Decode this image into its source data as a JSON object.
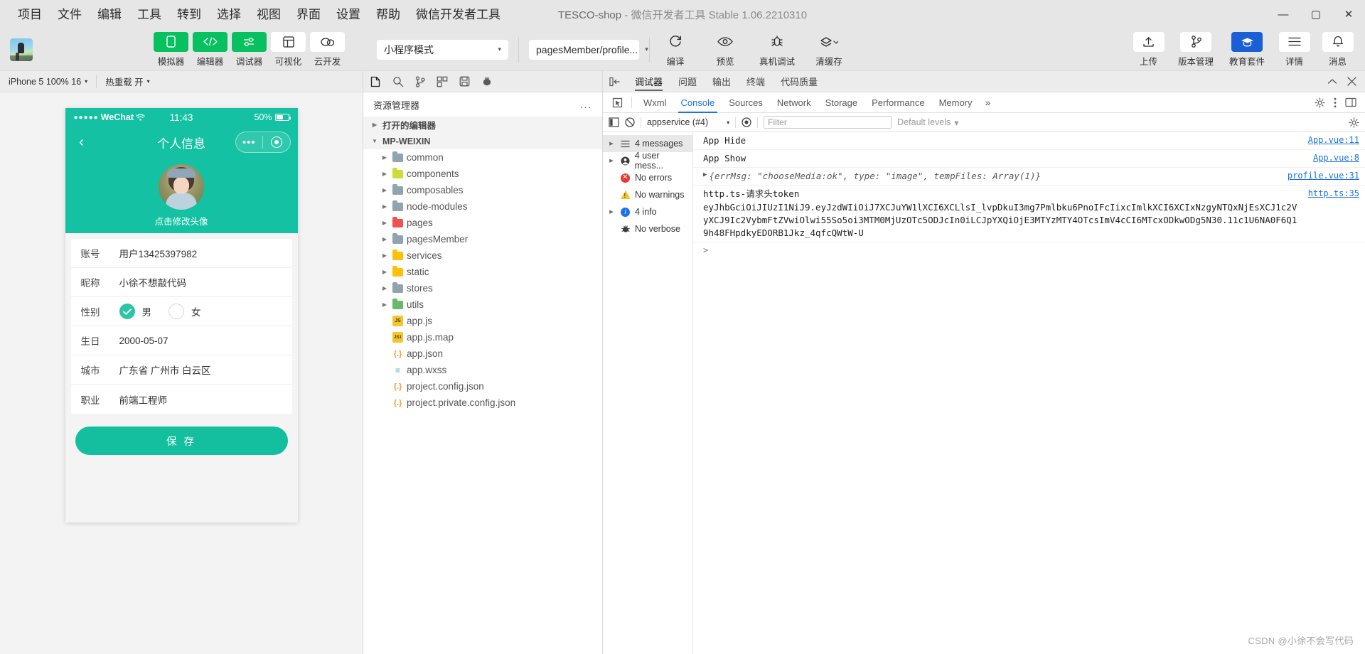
{
  "window": {
    "project": "TESCO-shop",
    "separator": "-",
    "app_version": "微信开发者工具 Stable 1.06.2210310",
    "minimize": "—",
    "maximize": "▢",
    "close": "✕"
  },
  "menubar": {
    "items": [
      {
        "label": "项目"
      },
      {
        "label": "文件"
      },
      {
        "label": "编辑"
      },
      {
        "label": "工具"
      },
      {
        "label": "转到"
      },
      {
        "label": "选择"
      },
      {
        "label": "视图"
      },
      {
        "label": "界面"
      },
      {
        "label": "设置"
      },
      {
        "label": "帮助"
      },
      {
        "label": "微信开发者工具"
      }
    ]
  },
  "toolbar": {
    "mode_buttons": [
      {
        "label": "模拟器",
        "icon": "phone-icon",
        "style": "green"
      },
      {
        "label": "编辑器",
        "icon": "code-icon",
        "style": "green"
      },
      {
        "label": "调试器",
        "icon": "sliders-icon",
        "style": "green"
      },
      {
        "label": "可视化",
        "icon": "layout-icon",
        "style": "white"
      },
      {
        "label": "云开发",
        "icon": "cloud-icon",
        "style": "white"
      }
    ],
    "compile_mode": {
      "value": "小程序模式",
      "caret": "▾"
    },
    "page_select": {
      "value": "pagesMember/profile...",
      "caret": "▾"
    },
    "actions": [
      {
        "label": "编译",
        "icon": "refresh-icon"
      },
      {
        "label": "预览",
        "icon": "eye-icon"
      },
      {
        "label": "真机调试",
        "icon": "bug-icon"
      },
      {
        "label": "清缓存",
        "icon": "layers-icon",
        "caret": "▾"
      }
    ],
    "right_actions": [
      {
        "label": "上传",
        "icon": "upload-icon"
      },
      {
        "label": "版本管理",
        "icon": "branch-icon"
      },
      {
        "label": "教育套件",
        "icon": "cap-icon"
      },
      {
        "label": "详情",
        "icon": "menu-icon"
      },
      {
        "label": "消息",
        "icon": "bell-icon"
      }
    ]
  },
  "simulator": {
    "device_bar": {
      "device": "iPhone 5 100% 16",
      "caret": "▾",
      "hotreload": "热重载 开",
      "hotreload_caret": "▾"
    },
    "status": {
      "carrier": "WeChat",
      "dots": "●●●●●",
      "wifi": "wifi-icon",
      "time": "11:43",
      "battery": "50%"
    },
    "nav": {
      "back": "‹",
      "title": "个人信息",
      "capsule_dots": "•••"
    },
    "hero": {
      "tip": "点击修改头像",
      "avatar": "user-avatar"
    },
    "form": [
      {
        "key": "账号",
        "value": "用户13425397982",
        "type": "text"
      },
      {
        "key": "昵称",
        "value": "小徐不想敲代码",
        "type": "text"
      },
      {
        "key": "性别",
        "type": "radio",
        "options": [
          {
            "label": "男",
            "selected": true
          },
          {
            "label": "女",
            "selected": false
          }
        ]
      },
      {
        "key": "生日",
        "value": "2000-05-07",
        "type": "text"
      },
      {
        "key": "城市",
        "value": "广东省 广州市 白云区",
        "type": "text"
      },
      {
        "key": "职业",
        "value": "前端工程师",
        "type": "text"
      }
    ],
    "save_button": "保 存"
  },
  "explorer": {
    "iconbar": [
      "files-icon",
      "search-icon",
      "source-control-icon",
      "extensions-icon",
      "save-all-icon",
      "debug-icon"
    ],
    "title": "资源管理器",
    "more": "...",
    "sections": [
      {
        "label": "打开的编辑器",
        "expanded": false,
        "arrow": "▶"
      },
      {
        "label": "MP-WEIXIN",
        "expanded": true,
        "arrow": "▼"
      }
    ],
    "tree": [
      {
        "name": "common",
        "kind": "folder",
        "color": "gray",
        "arrow": "▶"
      },
      {
        "name": "components",
        "kind": "folder",
        "color": "lime",
        "arrow": "▶"
      },
      {
        "name": "composables",
        "kind": "folder",
        "color": "gray",
        "arrow": "▶"
      },
      {
        "name": "node-modules",
        "kind": "folder",
        "color": "gray",
        "arrow": "▶"
      },
      {
        "name": "pages",
        "kind": "folder",
        "color": "red",
        "arrow": "▶"
      },
      {
        "name": "pagesMember",
        "kind": "folder",
        "color": "gray",
        "arrow": "▶"
      },
      {
        "name": "services",
        "kind": "folder",
        "color": "amber",
        "arrow": "▶"
      },
      {
        "name": "static",
        "kind": "folder",
        "color": "amber",
        "arrow": "▶"
      },
      {
        "name": "stores",
        "kind": "folder",
        "color": "gray",
        "arrow": "▶"
      },
      {
        "name": "utils",
        "kind": "folder",
        "color": "green",
        "arrow": "▶"
      },
      {
        "name": "app.js",
        "kind": "file",
        "ftype": "js",
        "badge": "JS"
      },
      {
        "name": "app.js.map",
        "kind": "file",
        "ftype": "map",
        "badge": "JS1"
      },
      {
        "name": "app.json",
        "kind": "file",
        "ftype": "json",
        "badge": "{.}"
      },
      {
        "name": "app.wxss",
        "kind": "file",
        "ftype": "wxss",
        "badge": "≡"
      },
      {
        "name": "project.config.json",
        "kind": "file",
        "ftype": "json",
        "badge": "{.}"
      },
      {
        "name": "project.private.config.json",
        "kind": "file",
        "ftype": "json",
        "badge": "{.}"
      }
    ]
  },
  "devtools": {
    "panel_tabs": [
      {
        "label": "调试器",
        "active": true
      },
      {
        "label": "问题",
        "active": false
      },
      {
        "label": "输出",
        "active": false
      },
      {
        "label": "终端",
        "active": false
      },
      {
        "label": "代码质量",
        "active": false
      }
    ],
    "panel_right_icons": [
      "chevron-up-icon",
      "close-icon"
    ],
    "dev_tabs": [
      {
        "label": "Wxml",
        "active": false
      },
      {
        "label": "Console",
        "active": true
      },
      {
        "label": "Sources",
        "active": false
      },
      {
        "label": "Network",
        "active": false
      },
      {
        "label": "Storage",
        "active": false
      },
      {
        "label": "Performance",
        "active": false
      },
      {
        "label": "Memory",
        "active": false
      }
    ],
    "dev_tabs_more": "»",
    "dev_right_icons": [
      "settings-gear-icon",
      "kebab-icon",
      "dock-icon"
    ],
    "console_toolbar": {
      "sidebar_toggle": "sidebar-toggle-icon",
      "clear": "clear-console-icon",
      "context": "appservice (#4)",
      "context_caret": "▾",
      "eye": "eye-icon",
      "filter_placeholder": "Filter",
      "levels": "Default levels",
      "levels_caret": "▾",
      "settings": "settings-gear-icon"
    },
    "console_sidebar": [
      {
        "label": "4 messages",
        "icon": "list-icon",
        "arrow": "▶",
        "selected": true
      },
      {
        "label": "4 user mess...",
        "icon": "user-icon",
        "arrow": "▶",
        "selected": false
      },
      {
        "label": "No errors",
        "icon": "error-icon",
        "arrow": "",
        "selected": false
      },
      {
        "label": "No warnings",
        "icon": "warning-icon",
        "arrow": "",
        "selected": false
      },
      {
        "label": "4 info",
        "icon": "info-icon",
        "arrow": "▶",
        "selected": false
      },
      {
        "label": "No verbose",
        "icon": "verbose-icon",
        "arrow": "",
        "selected": false
      }
    ],
    "messages": [
      {
        "text": "App Hide",
        "source": "App.vue:11",
        "expandable": false
      },
      {
        "text": "App Show",
        "source": "App.vue:8",
        "expandable": false
      },
      {
        "text": "{errMsg: \"chooseMedia:ok\", type: \"image\", tempFiles: Array(1)}",
        "source": "profile.vue:31",
        "expandable": true,
        "styled": true
      },
      {
        "text": "http.ts-请求头token\neyJhbGciOiJIUzI1NiJ9.eyJzdWIiOiJ7XCJuYW1lXCI6XCLlsI_lvpDkuI3mg7Pmlbku6PnoIFcIixcImlkXCI6XCIxNzgyNTQxNjEsXCJ1c2VyXCJ9Ic2VybmFtZVwiOlwi55So5oi3MTM0MjUzOTc5ODJcIn0iLCJpYXQiOjE3MTYzMTY4OTcsImV4cCI6MTcxODkwODg5N30.11c1U6NA0F6Q19h48FHpdkyEDORB1Jkz_4qfcQWtW-U",
        "source": "http.ts:35",
        "expandable": false
      }
    ],
    "prompt": ">"
  },
  "watermark": "CSDN @小徐不会写代码"
}
